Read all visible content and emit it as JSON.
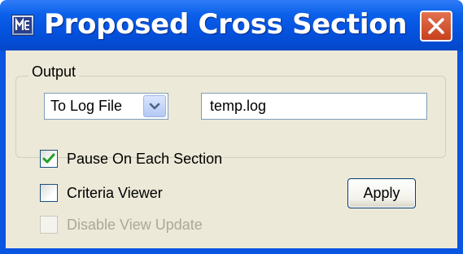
{
  "window": {
    "title": "Proposed Cross Section",
    "icon": "microstation-app-icon",
    "close_icon": "close-x-icon"
  },
  "output": {
    "group_label": "Output",
    "destination_selected": "To Log File",
    "file_name": "temp.log"
  },
  "options": {
    "pause_label": "Pause On Each Section",
    "pause_checked": true,
    "criteria_label": "Criteria Viewer",
    "criteria_checked": false,
    "disable_update_label": "Disable View Update",
    "disable_update_checked": false,
    "disable_update_enabled": false
  },
  "actions": {
    "apply_label": "Apply"
  },
  "colors": {
    "titlebar": "#0553e0",
    "client_bg": "#ece9d8",
    "close_red": "#d6512b",
    "check_green": "#21a121"
  }
}
